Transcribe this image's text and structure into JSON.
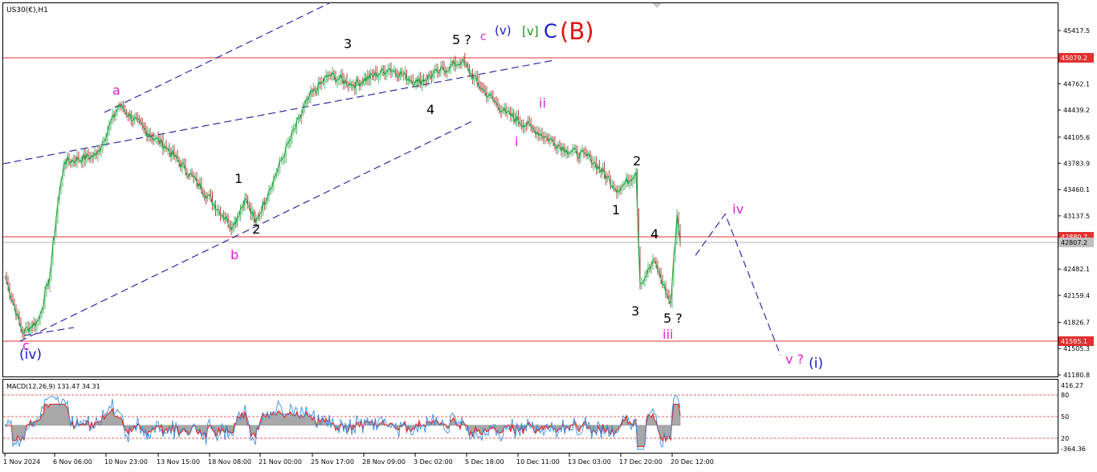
{
  "symbol_label": "US30(€),H1",
  "price_axis": {
    "ticks": [
      "45417.5",
      "45079.2",
      "44762.1",
      "44439.2",
      "44105.6",
      "43783.9",
      "43460.1",
      "43137.5",
      "42807.2",
      "42482.1",
      "42159.4",
      "41826.7",
      "41505.3",
      "41180.8"
    ],
    "level_labels": [
      "45079.2",
      "42880.7",
      "42807.2",
      "41595.1"
    ]
  },
  "macd": {
    "label": "MACD(12,26,9) 131.47 34.31",
    "axis_ticks": [
      "416.27",
      "80",
      "50",
      "20",
      "-364.36"
    ]
  },
  "time_axis": {
    "labels": [
      "1 Nov 2024",
      "6 Nov 06:00",
      "10 Nov 23:00",
      "13 Nov 15:00",
      "18 Nov 08:00",
      "21 Nov 00:00",
      "25 Nov 17:00",
      "28 Nov 09:00",
      "3 Dec 02:00",
      "5 Dec 18:00",
      "10 Dec 11:00",
      "13 Dec 03:00",
      "17 Dec 20:00",
      "20 Dec 12:00"
    ]
  },
  "wave_labels": {
    "top": [
      "5 ?",
      "c",
      "(v)",
      "[v]",
      "C",
      "(B)"
    ],
    "black": [
      "3",
      "4",
      "1",
      "2",
      "3",
      "4",
      "1",
      "2",
      "5 ?"
    ],
    "magenta": [
      "a",
      "b",
      "c",
      "ii",
      "i",
      "iii",
      "iv",
      "v ?"
    ],
    "blue": [
      "(iv)",
      "(i)"
    ]
  },
  "colors": {
    "candle": "#2ba84a",
    "candle_down": "#a01010",
    "level_line": "#e03030",
    "channel": "#1a1aa0",
    "magenta": "#e020d0",
    "blue": "#1a1ac8",
    "green": "#209020",
    "red": "#e01010",
    "macd_fill": "#a8a8a8",
    "macd_signal": "#e02020",
    "macd_main": "#3a8ee0"
  },
  "chart_data": {
    "type": "line",
    "title": "US30(€),H1",
    "x_range": [
      "1 Nov 2024",
      "20 Dec 2024"
    ],
    "ylim": [
      41180.8,
      45417.5
    ],
    "horizontal_levels": [
      45079.2,
      42880.7,
      41595.1
    ],
    "current_price": 42807.2,
    "series": [
      {
        "values": [
          {
            "x": "1 Nov 2024",
            "y": 42400
          },
          {
            "x": "1 Nov 2024",
            "y": 41700
          },
          {
            "x": "4 Nov 2024",
            "y": 41850
          },
          {
            "x": "5 Nov 2024",
            "y": 42400
          },
          {
            "x": "6 Nov 06:00",
            "y": 43300
          },
          {
            "x": "6 Nov 2024",
            "y": 43800
          },
          {
            "x": "8 Nov 2024",
            "y": 43880
          },
          {
            "x": "10 Nov 23:00",
            "y": 44500
          },
          {
            "x": "12 Nov 2024",
            "y": 44150
          },
          {
            "x": "13 Nov 15:00",
            "y": 44000
          },
          {
            "x": "15 Nov 2024",
            "y": 43550
          },
          {
            "x": "18 Nov 08:00",
            "y": 43000
          },
          {
            "x": "19 Nov 2024",
            "y": 43350
          },
          {
            "x": "20 Nov 2024",
            "y": 43050
          },
          {
            "x": "21 Nov 00:00",
            "y": 43450
          },
          {
            "x": "22 Nov 2024",
            "y": 44050
          },
          {
            "x": "25 Nov 17:00",
            "y": 44600
          },
          {
            "x": "26 Nov 2024",
            "y": 44870
          },
          {
            "x": "27 Nov 2024",
            "y": 44750
          },
          {
            "x": "28 Nov 09:00",
            "y": 44950
          },
          {
            "x": "2 Dec 2024",
            "y": 44780
          },
          {
            "x": "3 Dec 02:00",
            "y": 44900
          },
          {
            "x": "4 Dec 2024",
            "y": 45040
          },
          {
            "x": "5 Dec 18:00",
            "y": 44700
          },
          {
            "x": "9 Dec 2024",
            "y": 44400
          },
          {
            "x": "10 Dec 11:00",
            "y": 44200
          },
          {
            "x": "12 Dec 2024",
            "y": 43950
          },
          {
            "x": "13 Dec 03:00",
            "y": 43850
          },
          {
            "x": "16 Dec 2024",
            "y": 43450
          },
          {
            "x": "17 Dec 2024",
            "y": 43680
          },
          {
            "x": "18 Dec 2024",
            "y": 42300
          },
          {
            "x": "19 Dec 2024",
            "y": 42580
          },
          {
            "x": "20 Dec 2024",
            "y": 42050
          },
          {
            "x": "20 Dec 12:00",
            "y": 43150
          },
          {
            "x": "20 Dec 2024",
            "y": 42807.2
          }
        ]
      }
    ],
    "projection": [
      {
        "x": "23 Dec 2024",
        "y": 42650
      },
      {
        "x": "25 Dec 2024",
        "y": 43160
      },
      {
        "x": "30 Dec 2024",
        "y": 41420
      }
    ],
    "macd": {
      "params": "12,26,9",
      "main": 131.47,
      "signal": 34.31,
      "levels": [
        80,
        50,
        20
      ],
      "ylim": [
        -364.36,
        416.27
      ]
    }
  }
}
